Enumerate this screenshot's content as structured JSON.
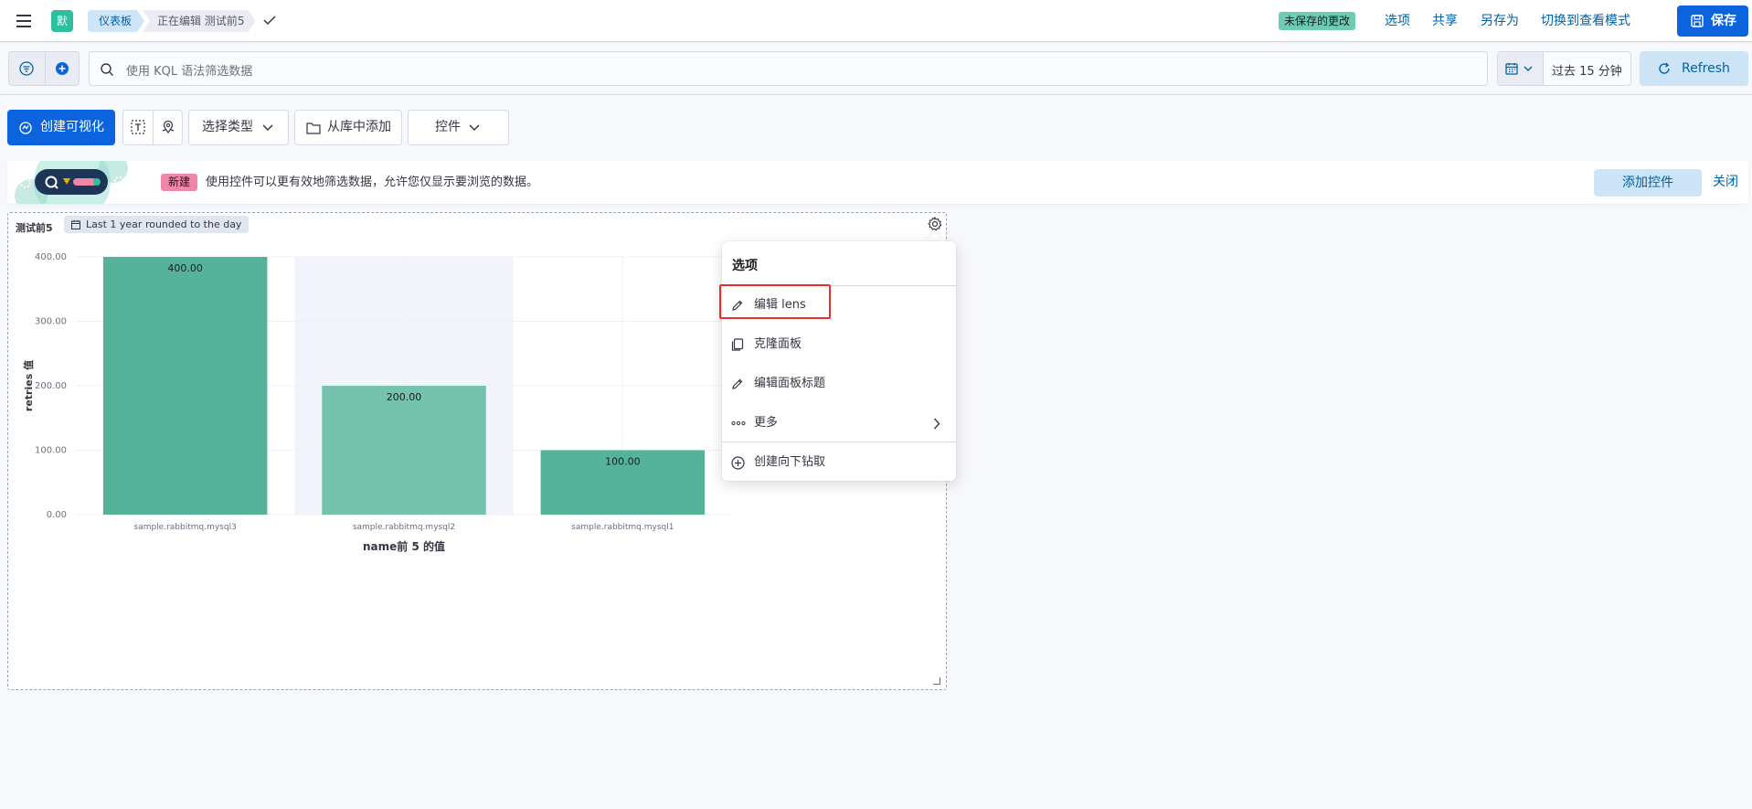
{
  "header": {
    "space_initial": "默",
    "breadcrumbs": [
      "仪表板",
      "正在编辑 测试前5"
    ],
    "unsaved_badge": "未保存的更改",
    "links": [
      "选项",
      "共享",
      "另存为",
      "切换到查看模式"
    ],
    "save_label": "保存"
  },
  "query": {
    "placeholder": "使用 KQL 语法筛选数据",
    "time_range": "过去 15 分钟",
    "refresh_label": "Refresh"
  },
  "toolbar": {
    "create_label": "创建可视化",
    "select_type_label": "选择类型",
    "add_from_library_label": "从库中添加",
    "controls_label": "控件"
  },
  "callout": {
    "badge": "新建",
    "text": "使用控件可以更有效地筛选数据，允许您仅显示要浏览的数据。",
    "add_button": "添加控件",
    "close": "关闭"
  },
  "panel": {
    "title": "测试前5",
    "time_badge": "Last 1 year rounded to the day"
  },
  "context_menu": {
    "title": "选项",
    "items": [
      "编辑 lens",
      "克隆面板",
      "编辑面板标题",
      "更多",
      "创建向下钻取"
    ]
  },
  "colors": {
    "bar": "#54b399",
    "bar_light": "#75c2ad",
    "primary": "#0b64dd",
    "link": "#0061a6",
    "highlight": "#e7302a"
  },
  "chart_data": {
    "type": "bar",
    "categories": [
      "sample.rabbitmq.mysql3",
      "sample.rabbitmq.mysql2",
      "sample.rabbitmq.mysql1"
    ],
    "values": [
      400,
      200,
      100
    ],
    "data_labels": [
      "400.00",
      "200.00",
      "100.00"
    ],
    "xlabel": "name前 5 的值",
    "ylabel": "retries 值",
    "ylim": [
      0,
      400
    ],
    "yticks": [
      "0.00",
      "100.00",
      "200.00",
      "300.00",
      "400.00"
    ],
    "highlighted_category": "sample.rabbitmq.mysql2",
    "grid": true
  }
}
